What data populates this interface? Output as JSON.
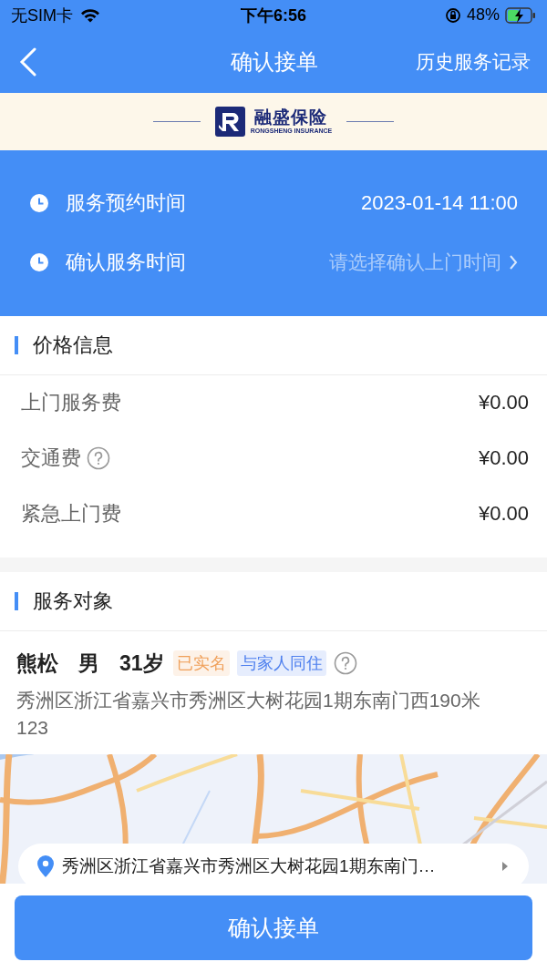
{
  "status_bar": {
    "carrier": "无SIM卡",
    "time": "下午6:56",
    "battery": "48%",
    "charging": true
  },
  "nav": {
    "title": "确认接单",
    "action": "历史服务记录"
  },
  "banner": {
    "logo_name": "融盛保险",
    "logo_subtitle": "RONGSHENG INSURANCE"
  },
  "times": [
    {
      "kind": "value",
      "label": "服务预约时间",
      "value": "2023-01-14 11:00"
    },
    {
      "kind": "picker",
      "label": "确认服务时间",
      "placeholder": "请选择确认上门时间"
    }
  ],
  "price": {
    "title": "价格信息",
    "rows": [
      {
        "label": "上门服务费",
        "amount": "¥0.00",
        "help": false
      },
      {
        "label": "交通费",
        "amount": "¥0.00",
        "help": true
      },
      {
        "label": "紧急上门费",
        "amount": "¥0.00",
        "help": false
      }
    ]
  },
  "service_target": {
    "title": "服务对象",
    "name": "熊松",
    "gender": "男",
    "age": "31岁",
    "tags": [
      {
        "label": "已实名",
        "color": "#f0a05a"
      },
      {
        "label": "与家人同住",
        "color": "#4f80ee"
      }
    ],
    "address": "秀洲区浙江省嘉兴市秀洲区大树花园1期东南门西190米123",
    "map": {
      "kind": "picture",
      "address": "秀洲区浙江省嘉兴市秀洲区大树花园1期东南门…"
    }
  },
  "confirm_button": "确认接单"
}
